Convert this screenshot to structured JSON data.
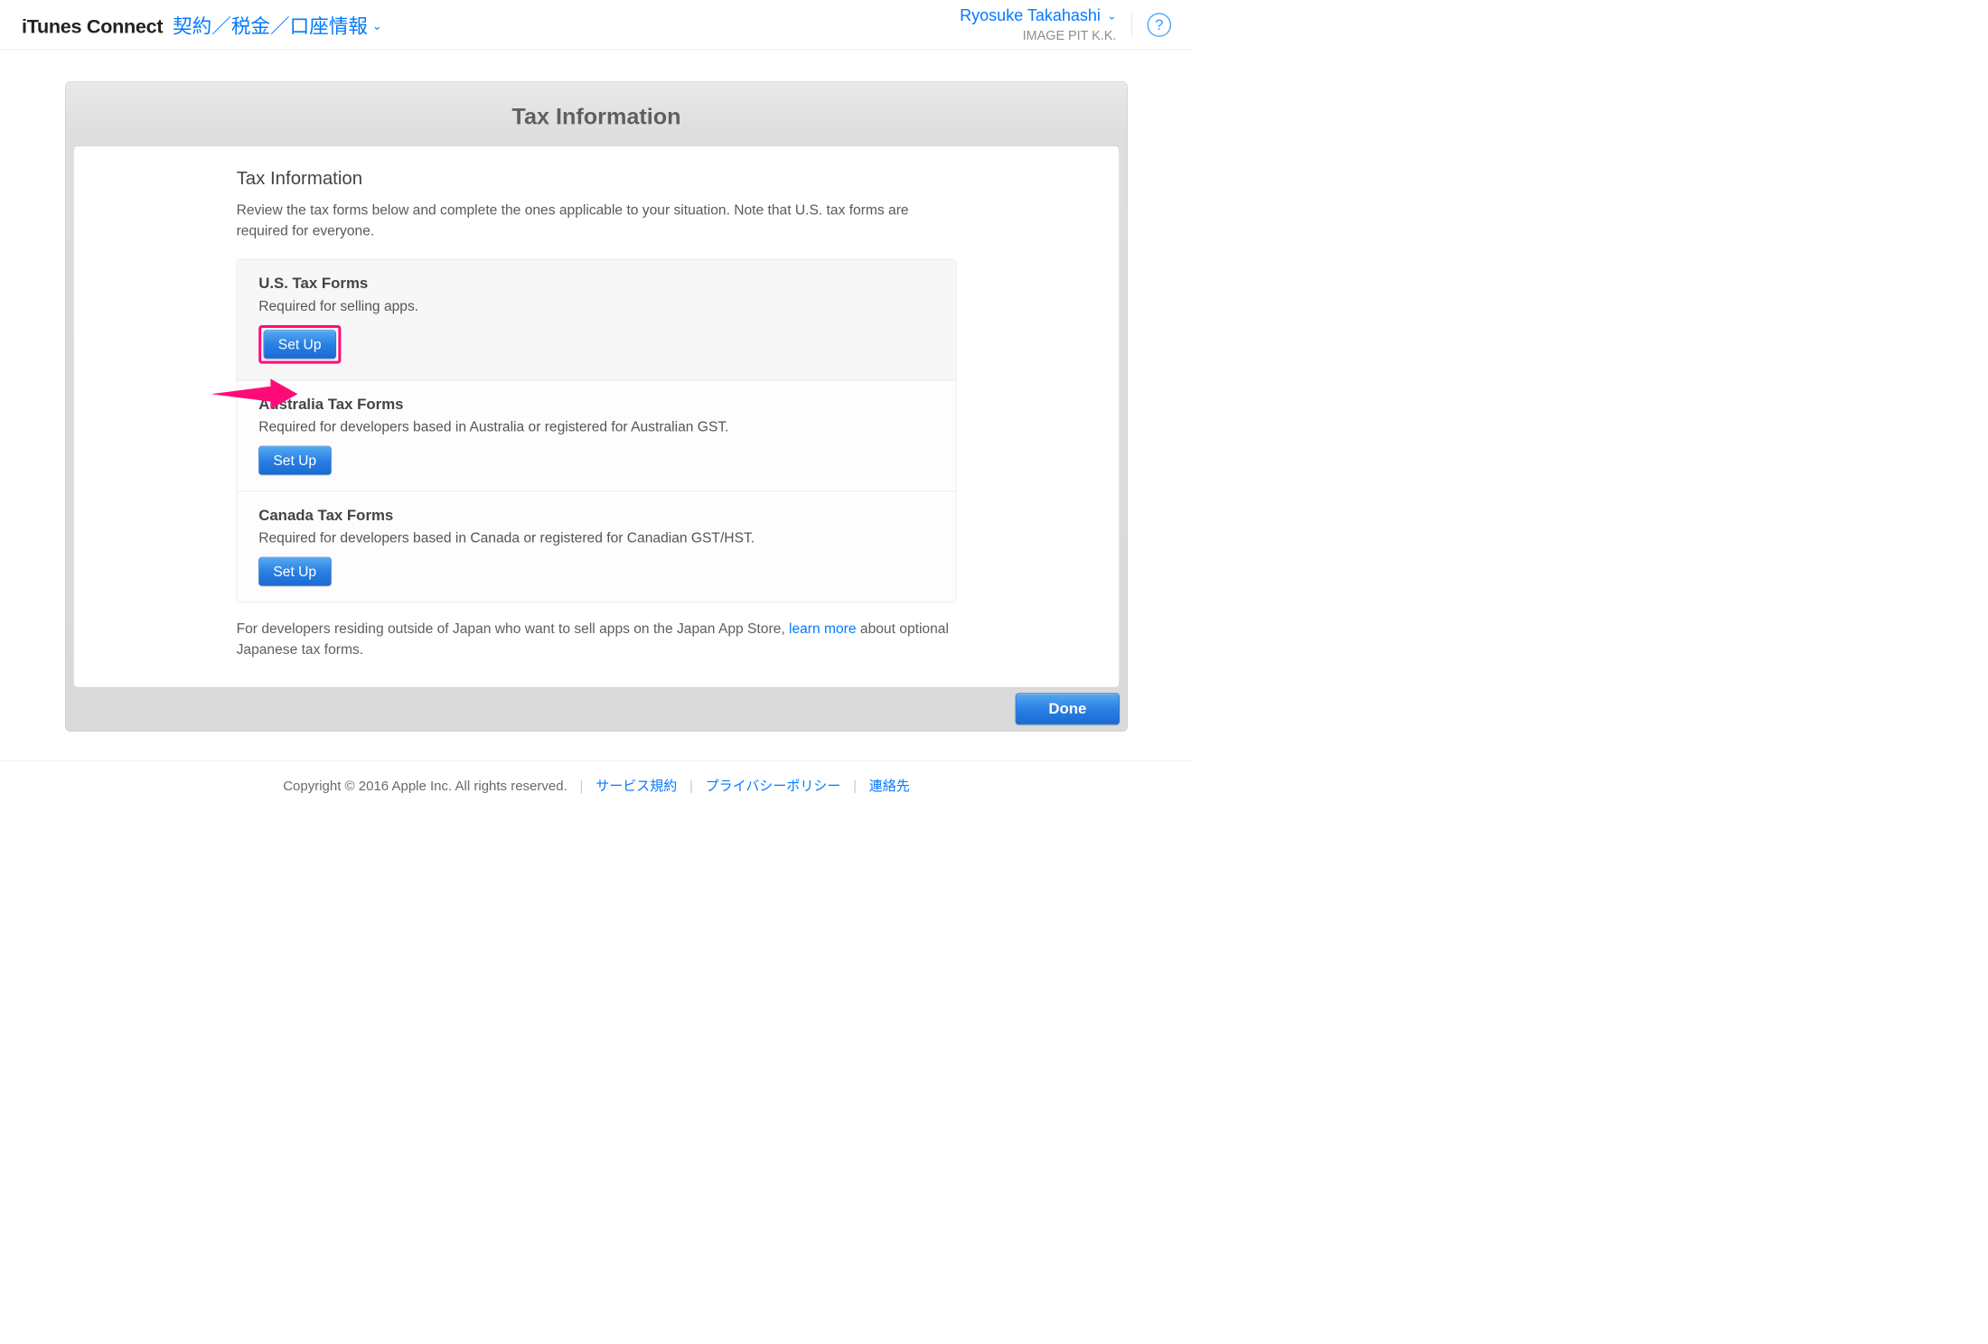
{
  "header": {
    "app_title": "iTunes Connect",
    "breadcrumb": "契約／税金／口座情報",
    "user_name": "Ryosuke Takahashi",
    "company": "IMAGE PIT K.K.",
    "help_glyph": "?"
  },
  "panel": {
    "heading": "Tax Information",
    "section_title": "Tax Information",
    "section_desc": "Review the tax forms below and complete the ones applicable to your situation. Note that U.S. tax forms are required for everyone.",
    "cards": [
      {
        "title": "U.S. Tax Forms",
        "desc": "Required for selling apps.",
        "button": "Set Up",
        "highlighted": true
      },
      {
        "title": "Australia Tax Forms",
        "desc": "Required for developers based in Australia or registered for Australian GST.",
        "button": "Set Up",
        "highlighted": false
      },
      {
        "title": "Canada Tax Forms",
        "desc": "Required for developers based in Canada or registered for Canadian GST/HST.",
        "button": "Set Up",
        "highlighted": false
      }
    ],
    "footnote_pre": "For developers residing outside of Japan who want to sell apps on the Japan App Store, ",
    "footnote_link": "learn more",
    "footnote_post": " about optional Japanese tax forms.",
    "done": "Done"
  },
  "footer": {
    "copyright": "Copyright © 2016 Apple Inc. All rights reserved.",
    "links": [
      "サービス規約",
      "プライバシーポリシー",
      "連絡先"
    ]
  }
}
